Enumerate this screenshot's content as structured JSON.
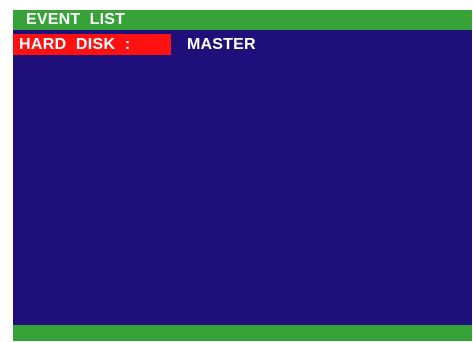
{
  "title": "EVENT  LIST",
  "entry": {
    "label": "HARD  DISK  :",
    "value": "MASTER"
  },
  "colors": {
    "background": "#1e0f7a",
    "bar": "#36a238",
    "highlight": "#ff1111",
    "text": "#ffffff"
  }
}
